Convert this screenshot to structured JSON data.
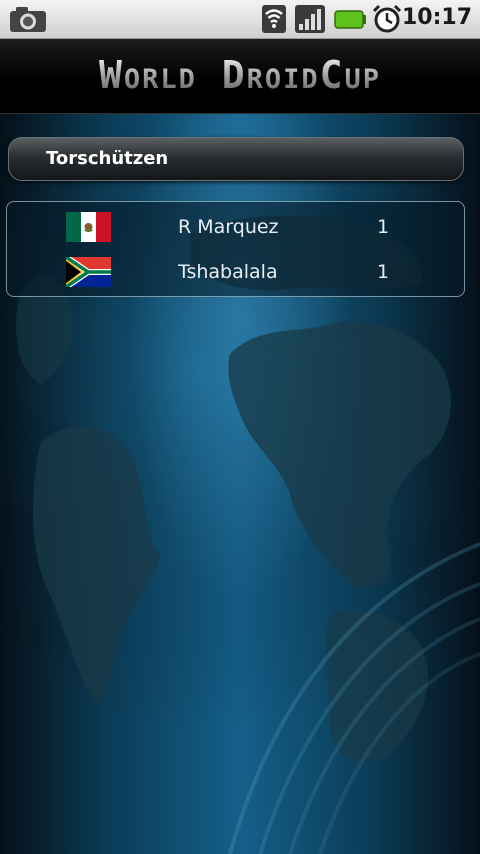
{
  "status_bar": {
    "time": "10:17",
    "icons": [
      "camera-icon",
      "wifi-icon",
      "signal-icon",
      "battery-icon",
      "alarm-icon"
    ]
  },
  "header": {
    "title": "World DroidCup"
  },
  "section": {
    "title": "Torschützen"
  },
  "scorers": [
    {
      "flag": "mexico-flag-icon",
      "name": "R Marquez",
      "goals": "1"
    },
    {
      "flag": "south-africa-flag-icon",
      "name": "Tshabalala",
      "goals": "1"
    }
  ],
  "colors": {
    "background_center": "#14608a",
    "background_edge": "#041018",
    "header_bg": "#000000",
    "text": "#e6eef2"
  }
}
